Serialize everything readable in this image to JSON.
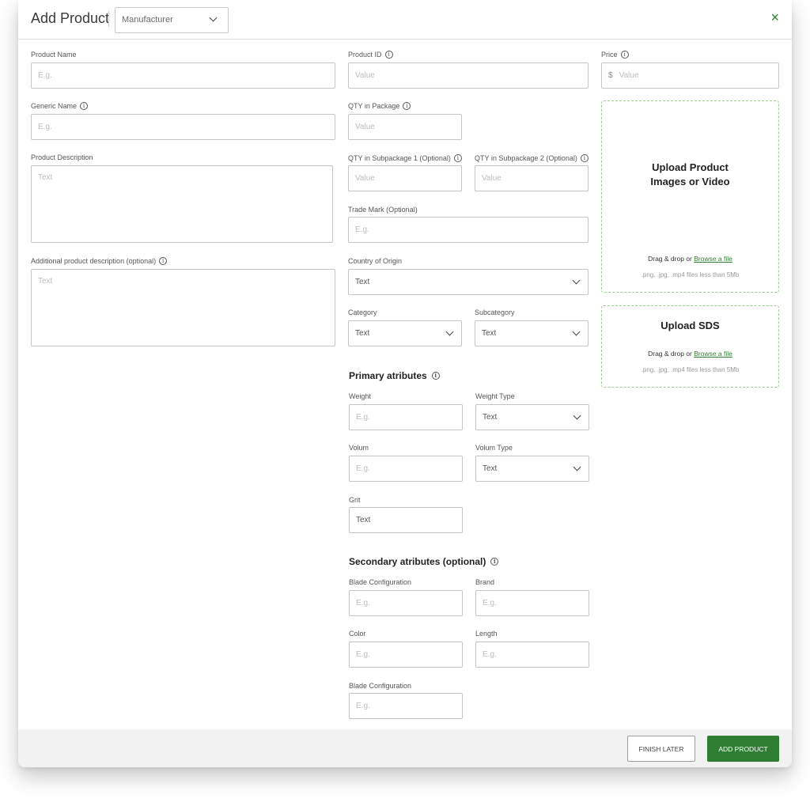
{
  "header": {
    "title": "Add Product",
    "manufacturer_select": "Manufacturer",
    "close": "×"
  },
  "form": {
    "product_name": {
      "label": "Product Name",
      "placeholder": "E.g."
    },
    "product_id": {
      "label": "Product ID",
      "placeholder": "Value"
    },
    "price": {
      "label": "Price",
      "currency": "$",
      "placeholder": "Value"
    },
    "generic_name": {
      "label": "Generic Name",
      "placeholder": "E.g."
    },
    "qty_package": {
      "label": "QTY in Package",
      "placeholder": "Value"
    },
    "product_description": {
      "label": "Product Description",
      "placeholder": "Text"
    },
    "qty_sub1": {
      "label": "QTY in Subpackage 1 (Optional)",
      "placeholder": "Value"
    },
    "qty_sub2": {
      "label": "QTY in Subpackage 2 (Optional)",
      "placeholder": "Value"
    },
    "trade_mark": {
      "label": "Trade Mark (Optional)",
      "placeholder": "E.g."
    },
    "additional_description": {
      "label": "Additional product description (optional)",
      "placeholder": "Text"
    },
    "country": {
      "label": "Country of Origin",
      "value": "Text"
    },
    "category": {
      "label": "Category",
      "value": "Text"
    },
    "subcategory": {
      "label": "Subcategory",
      "value": "Text"
    }
  },
  "primary": {
    "title": "Primary atributes",
    "weight": {
      "label": "Weight",
      "placeholder": "E.g."
    },
    "weight_type": {
      "label": "Weight Type",
      "value": "Text"
    },
    "volum": {
      "label": "Volum",
      "placeholder": "E.g."
    },
    "volum_type": {
      "label": "Volum Type",
      "value": "Text"
    },
    "grit": {
      "label": "Grit",
      "value": "Text"
    }
  },
  "secondary": {
    "title": "Secondary atributes (optional)",
    "blade1": {
      "label": "Blade Configuration",
      "placeholder": "E.g."
    },
    "brand": {
      "label": "Brand",
      "placeholder": "E.g."
    },
    "color": {
      "label": "Color",
      "placeholder": "E.g."
    },
    "length": {
      "label": "Length",
      "placeholder": "E.g."
    },
    "blade2": {
      "label": "Blade Configuration",
      "placeholder": "E.g."
    }
  },
  "upload_media": {
    "title_line1": "Upload Product",
    "title_line2": "Images or Video",
    "drag": "Drag & drop or",
    "browse": "Browse a file",
    "hint": ".png, .jpg, .mp4 files less than 5Mb"
  },
  "upload_sds": {
    "title": "Upload SDS",
    "drag": "Drag & drop or",
    "browse": "Browse a file",
    "hint": ".png, .jpg, .mp4 files less than 5Mb"
  },
  "footer": {
    "finish_later": "FINISH LATER",
    "add_product": "ADD PRODUCT"
  },
  "colors": {
    "accent": "#2e7d32",
    "dashed_border": "#9ccf8f",
    "footer_bg": "#f2f2f2"
  }
}
